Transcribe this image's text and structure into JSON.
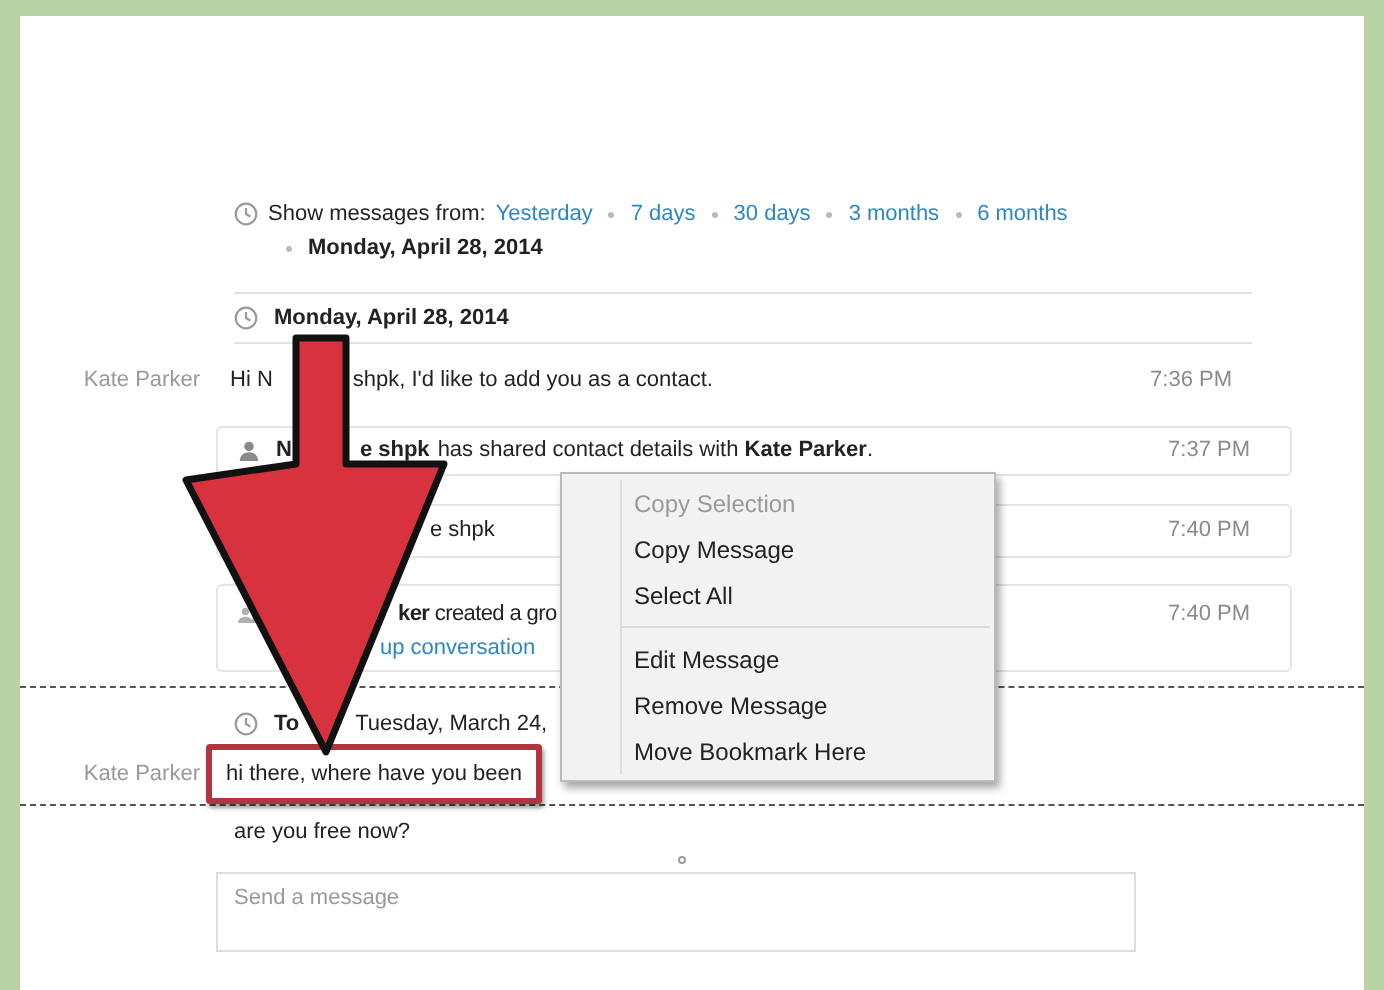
{
  "history_bar": {
    "label": "Show messages from:",
    "options": [
      "Yesterday",
      "7 days",
      "30 days",
      "3 months",
      "6 months"
    ],
    "current": "Monday, April 28, 2014"
  },
  "sections": [
    {
      "date_parts": [
        "Monday, April 28, 2014"
      ],
      "selected": false,
      "messages": [
        {
          "kind": "text",
          "sender": "Kate Parker",
          "parts": [
            "Hi N",
            "shpk, I'd like to add you as a contact."
          ],
          "time": "7:36 PM",
          "highlighted": false
        },
        {
          "kind": "contact",
          "parts": [
            "N",
            "e shpk",
            "has shared contact details with **Kate Parker**."
          ],
          "time": "7:37 PM"
        },
        {
          "kind": "contact-card",
          "parts": [
            "e shpk"
          ],
          "time": "7:40 PM"
        },
        {
          "kind": "group",
          "parts": [
            "**ker** created a gro"
          ],
          "link": "up conversation",
          "time": "7:40 PM"
        }
      ]
    },
    {
      "date_parts": [
        "To",
        "Tuesday, March 24,"
      ],
      "selected": true,
      "messages": [
        {
          "kind": "text",
          "sender": "Kate Parker",
          "parts": [
            "hi there, where have you been"
          ],
          "highlighted": true
        }
      ]
    }
  ],
  "trailing_message": "are you free now?",
  "composer": {
    "placeholder": "Send a message"
  },
  "context_menu": [
    [
      {
        "label": "Copy Selection",
        "disabled": true
      },
      {
        "label": "Copy Message",
        "disabled": false
      },
      {
        "label": "Select All",
        "disabled": false
      }
    ],
    [
      {
        "label": "Edit Message",
        "disabled": false
      },
      {
        "label": "Remove Message",
        "disabled": false
      },
      {
        "label": "Move Bookmark Here",
        "disabled": false
      }
    ]
  ]
}
